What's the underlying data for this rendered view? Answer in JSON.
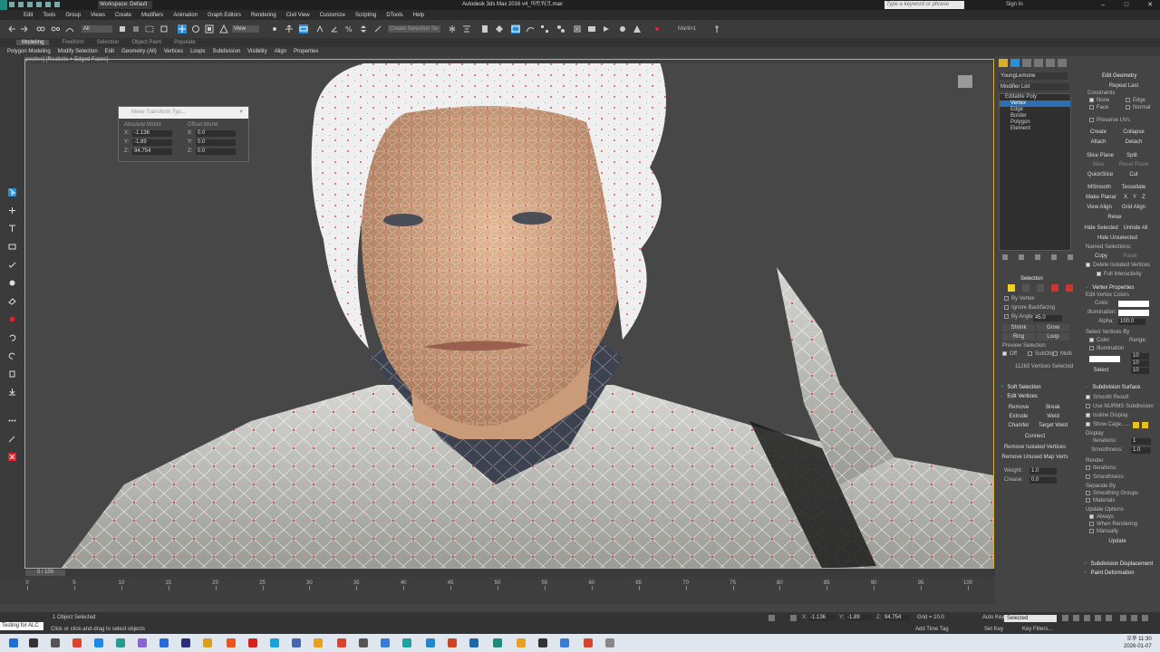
{
  "window": {
    "workspace": "Workspace: Default",
    "title": "Autodesk 3ds Max 2016   v4_아트워크.max",
    "search_placeholder": "Type a keyword or phrase",
    "signin": "Sign In"
  },
  "menu": [
    "Edit",
    "Tools",
    "Group",
    "Views",
    "Create",
    "Modifiers",
    "Animation",
    "Graph Editors",
    "Rendering",
    "Civil View",
    "Customize",
    "Scripting",
    "DTools",
    "Help"
  ],
  "toolbar": {
    "selection_filter": "All",
    "ref_coord": "View",
    "named_selection": "Create Selection Se",
    "material_label": "Martin1"
  },
  "ribbon": {
    "tabs": [
      "Modeling",
      "Freeform",
      "Selection",
      "Object Paint",
      "Populate"
    ],
    "active_tab": "Modeling",
    "subitems": [
      "Polygon Modeling",
      "Modify Selection",
      "Edit",
      "Geometry (All)",
      "Vertices",
      "Loops",
      "Subdivision",
      "Visibility",
      "Align",
      "Properties"
    ]
  },
  "viewport": {
    "label": "[+] [Perspective] [Realistic + Edged Faces]"
  },
  "transform_dialog": {
    "title": "Move Transform Typ...",
    "close": "×",
    "absolute_label": "Absolute:World",
    "offset_label": "Offset:World",
    "absolute": {
      "x": "-1.136",
      "y": "-1.89",
      "z": "94.754"
    },
    "offset": {
      "x": "0.0",
      "y": "0.0",
      "z": "0.0"
    },
    "axes": [
      "X:",
      "Y:",
      "Z:"
    ]
  },
  "command_panel": {
    "object_name": "YoungLemone",
    "modifier_list": "Modifier List",
    "stack": [
      {
        "label": "Editable Poly",
        "kind": "root"
      },
      {
        "label": "Vertex",
        "kind": "selected"
      },
      {
        "label": "Edge",
        "kind": "sub"
      },
      {
        "label": "Border",
        "kind": "sub"
      },
      {
        "label": "Polygon",
        "kind": "sub"
      },
      {
        "label": "Element",
        "kind": "sub"
      }
    ],
    "selection": {
      "header": "Selection",
      "by_vertex": "By Vertex",
      "ignore_backfacing": "Ignore Backfacing",
      "by_angle": "By Angle:",
      "angle_value": "45.0",
      "shrink": "Shrink",
      "grow": "Grow",
      "ring": "Ring",
      "loop": "Loop",
      "preview_selection": "Preview Selection",
      "preview_opts": [
        "Off",
        "SubObj",
        "Multi"
      ],
      "count": "11263 Vertices Selected"
    },
    "soft_selection": "Soft Selection",
    "edit_vertices": {
      "header": "Edit Vertices",
      "buttons": [
        "Remove",
        "Break",
        "Extrude",
        "Weld",
        "Chamfer",
        "Target Weld",
        "Connect",
        "Remove Isolated Vertices",
        "Remove Unused Map Verts"
      ],
      "weight_label": "Weight:",
      "weight": "1.0",
      "crease_label": "Crease:",
      "crease": "0.0"
    },
    "edit_geometry": {
      "header": "Edit Geometry",
      "repeat_last": "Repeat Last",
      "constraints": "Constraints",
      "c_opts": [
        "None",
        "Edge",
        "Face",
        "Normal"
      ],
      "preserve_uvs": "Preserve UVs",
      "buttons": [
        "Create",
        "Collapse",
        "Attach",
        "Detach",
        "Slice Plane",
        "Split",
        "Slice",
        "Reset Plane",
        "QuickSlice",
        "Cut",
        "MSmooth",
        "Tessellate",
        "Make Planar",
        "X",
        "Y",
        "Z",
        "View Align",
        "Grid Align",
        "Relax",
        "Hide Selected",
        "Unhide All",
        "Hide Unselected"
      ],
      "named_selections": "Named Selections:",
      "copy": "Copy",
      "paste": "Paste",
      "delete_isolated": "Delete Isolated Vertices",
      "full_interactivity": "Full Interactivity"
    },
    "vertex_properties": {
      "header": "Vertex Properties",
      "edit_colors": "Edit Vertex Colors",
      "color": "Color:",
      "illumination": "Illumination:",
      "alpha": "Alpha:",
      "alpha_val": "100.0",
      "select_by": "Select Vertices By",
      "sb_color": "Color",
      "sb_illum": "Illumination",
      "range": "Range:",
      "r": "10",
      "g": "10",
      "b": "10",
      "select": "Select"
    },
    "subdivision_surface": {
      "header": "Subdivision Surface",
      "smooth_result": "Smooth Result",
      "use_nurms": "Use NURMS Subdivision",
      "isoline": "Isoline Display",
      "show_cage": "Show Cage......",
      "display": "Display",
      "iterations": "Iterations:",
      "iter_val": "1",
      "smoothness": "Smoothness:",
      "smooth_val": "1.0",
      "render": "Render",
      "separate_by": "Separate By",
      "smoothing_groups": "Smoothing Groups",
      "materials": "Materials",
      "update_options": "Update Options",
      "always": "Always",
      "when_rendering": "When Rendering",
      "manually": "Manually",
      "update": "Update"
    },
    "subdivision_displacement": "Subdivision Displacement",
    "paint_deformation": "Paint Deformation"
  },
  "timeline": {
    "frame": "0 / 100",
    "ticks": [
      "0",
      "5",
      "10",
      "15",
      "20",
      "25",
      "30",
      "35",
      "40",
      "45",
      "50",
      "55",
      "60",
      "65",
      "70",
      "75",
      "80",
      "85",
      "90",
      "95",
      "100"
    ]
  },
  "status": {
    "message": "1 Object Selected",
    "hint": "Click or click-and-drag to select objects",
    "script_prompt": "Testing for ALC",
    "x_label": "X:",
    "x": "-1.136",
    "y_label": "Y:",
    "y": "-1.89",
    "z_label": "Z:",
    "z": "94.754",
    "grid": "Grid = 10.0",
    "add_time_tag": "Add Time Tag",
    "auto_key": "Auto Key",
    "set_key": "Set Key",
    "selected": "Selected",
    "key_filters": "Key Filters..."
  },
  "taskbar": {
    "time": "오후 11:30",
    "date": "2026-01-07"
  },
  "colors": {
    "accent": "#2b8fd8",
    "viewport_border": "#d6b22c",
    "vertex": "#e0212b",
    "skin": "#d9ad8a"
  }
}
